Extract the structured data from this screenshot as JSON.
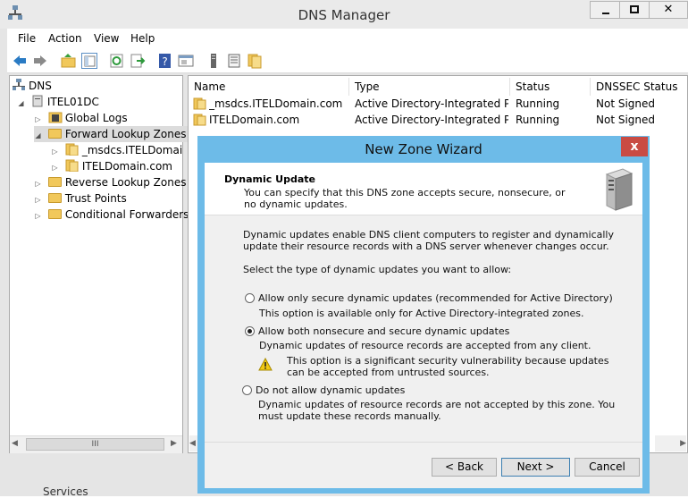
{
  "window": {
    "title": "DNS Manager"
  },
  "menu": [
    "File",
    "Action",
    "View",
    "Help"
  ],
  "tree": {
    "root": "DNS",
    "server": "ITEL01DC",
    "nodes": [
      "Global Logs",
      "Forward Lookup Zones",
      "_msdcs.ITELDomain.c",
      "ITELDomain.com",
      "Reverse Lookup Zones",
      "Trust Points",
      "Conditional Forwarders"
    ]
  },
  "tree_scroll_thumb": "III",
  "list": {
    "columns": [
      "Name",
      "Type",
      "Status",
      "DNSSEC Status"
    ],
    "rows": [
      [
        "_msdcs.ITELDomain.com",
        "Active Directory-Integrated Pr...",
        "Running",
        "Not Signed"
      ],
      [
        "ITELDomain.com",
        "Active Directory-Integrated Pr...",
        "Running",
        "Not Signed"
      ]
    ]
  },
  "status_bar": {
    "text": "Services"
  },
  "wizard": {
    "title": "New Zone Wizard",
    "close": "x",
    "header_title": "Dynamic Update",
    "header_desc": "You can specify that this DNS zone accepts secure, nonsecure, or no dynamic updates.",
    "intro": "Dynamic updates enable DNS client computers to register and dynamically update their resource records with a DNS server whenever changes occur.",
    "prompt": "Select the type of dynamic updates you want to allow:",
    "options": [
      {
        "label": "Allow only secure dynamic updates (recommended for Active Directory)",
        "desc": "This option is available only for Active Directory-integrated zones.",
        "selected": false
      },
      {
        "label": "Allow both nonsecure and secure dynamic updates",
        "desc": "Dynamic updates of resource records are accepted from any client.",
        "selected": true
      },
      {
        "label": "Do not allow dynamic updates",
        "desc": "Dynamic updates of resource records are not accepted by this zone. You must update these records manually.",
        "selected": false
      }
    ],
    "warning": "This option is a significant security vulnerability because updates can be accepted from untrusted sources.",
    "buttons": {
      "back": "< Back",
      "next": "Next >",
      "cancel": "Cancel"
    }
  },
  "colors": {
    "wizard_frame": "#6dbbe8",
    "close_button": "#c94b43",
    "selection": "#dcdcdc"
  }
}
